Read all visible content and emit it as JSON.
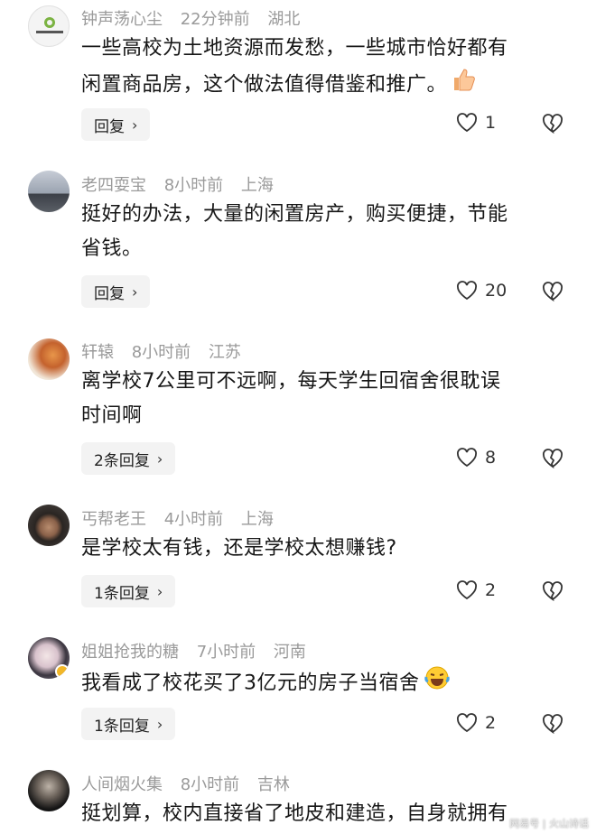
{
  "comments": [
    {
      "user": "钟声荡心尘",
      "time": "22分钟前",
      "location": "湖北",
      "text_lines": [
        "一些高校为土地资源而发愁，一些城市恰好都有",
        "闲置商品房，这个做法值得借鉴和推广。"
      ],
      "emoji": "thumbs-up",
      "reply_label": "回复",
      "likes": "1"
    },
    {
      "user": "老四耍宝",
      "time": "8小时前",
      "location": "上海",
      "text_lines": [
        "挺好的办法，大量的闲置房产，购买便捷，节能",
        "省钱。"
      ],
      "reply_label": "回复",
      "likes": "20"
    },
    {
      "user": "轩辕",
      "time": "8小时前",
      "location": "江苏",
      "text_lines": [
        "离学校7公里可不远啊，每天学生回宿舍很耽误",
        "时间啊"
      ],
      "reply_label": "2条回复",
      "likes": "8"
    },
    {
      "user": "丐帮老王",
      "time": "4小时前",
      "location": "上海",
      "text_lines": [
        "是学校太有钱，还是学校太想赚钱?"
      ],
      "reply_label": "1条回复",
      "likes": "2"
    },
    {
      "user": "姐姐抢我的糖",
      "time": "7小时前",
      "location": "河南",
      "text_lines": [
        "我看成了校花买了3亿元的房子当宿舍"
      ],
      "emoji": "laughing-crying",
      "reply_label": "1条回复",
      "likes": "2"
    },
    {
      "user": "人间烟火集",
      "time": "8小时前",
      "location": "吉林",
      "text_lines": [
        "挺划算，校内直接省了地皮和建造，自身就拥有"
      ]
    }
  ],
  "watermark": "网易号 | 火山诗话"
}
